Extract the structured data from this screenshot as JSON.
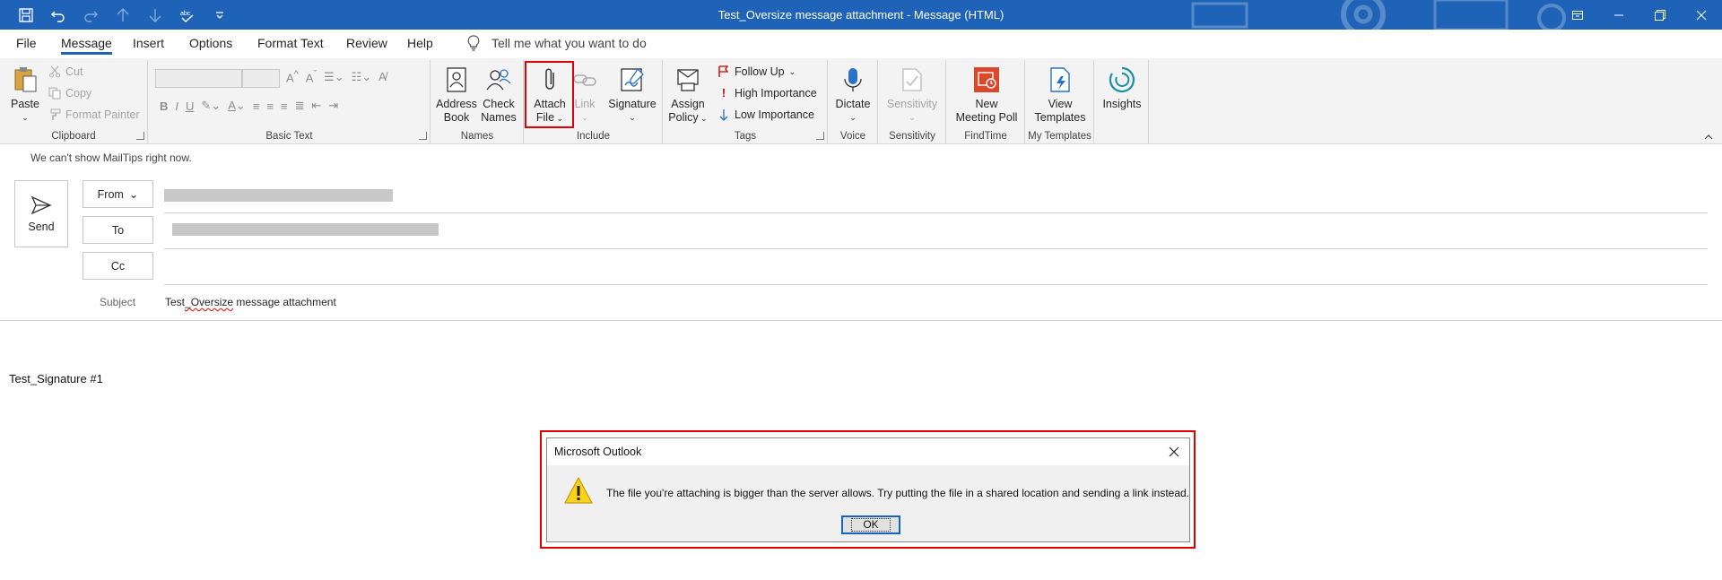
{
  "window": {
    "title": "Test_Oversize message attachment  -  Message (HTML)",
    "accent_color": "#1e63b7"
  },
  "quick_access": [
    "save-icon",
    "undo-icon",
    "redo-icon",
    "up-arrow-icon",
    "down-arrow-icon",
    "spelling-icon",
    "customize-qat-icon"
  ],
  "window_controls": [
    "ribbon-display-options-icon",
    "minimize-icon",
    "restore-icon",
    "close-icon"
  ],
  "menu": {
    "tabs": [
      "File",
      "Message",
      "Insert",
      "Options",
      "Format Text",
      "Review",
      "Help"
    ],
    "active_tab": "Message",
    "tell_me": "Tell me what you want to do"
  },
  "ribbon": {
    "clipboard": {
      "label": "Clipboard",
      "paste": "Paste",
      "cut": "Cut",
      "copy": "Copy",
      "format_painter": "Format Painter"
    },
    "basic_text": {
      "label": "Basic Text"
    },
    "names": {
      "label": "Names",
      "address_book": [
        "Address",
        "Book"
      ],
      "check_names": [
        "Check",
        "Names"
      ]
    },
    "include": {
      "label": "Include",
      "attach_file": [
        "Attach",
        "File"
      ],
      "link": "Link",
      "signature": "Signature"
    },
    "tags": {
      "label": "Tags",
      "assign_policy": [
        "Assign",
        "Policy"
      ],
      "follow_up": "Follow Up",
      "high_importance": "High Importance",
      "low_importance": "Low Importance"
    },
    "voice": {
      "label": "Voice",
      "dictate": "Dictate"
    },
    "sensitivity": {
      "label": "Sensitivity",
      "button": "Sensitivity"
    },
    "findtime": {
      "label": "FindTime",
      "new_meeting_poll": [
        "New",
        "Meeting Poll"
      ]
    },
    "my_templates": {
      "label": "My Templates",
      "view_templates": [
        "View",
        "Templates"
      ]
    },
    "insights": {
      "button": "Insights"
    }
  },
  "compose": {
    "mailtips": "We can't show MailTips right now.",
    "send": "Send",
    "from": "From",
    "to": "To",
    "cc": "Cc",
    "subject_label": "Subject",
    "subject_prefix": "Test",
    "subject_underlined": "_Oversize",
    "subject_rest": " message attachment",
    "signature": "Test_Signature #1"
  },
  "dialog": {
    "title": "Microsoft Outlook",
    "message": "The file you're attaching is bigger than the server allows. Try putting the file in a shared location and sending a link instead.",
    "ok": "OK",
    "icon": "warning-icon"
  }
}
